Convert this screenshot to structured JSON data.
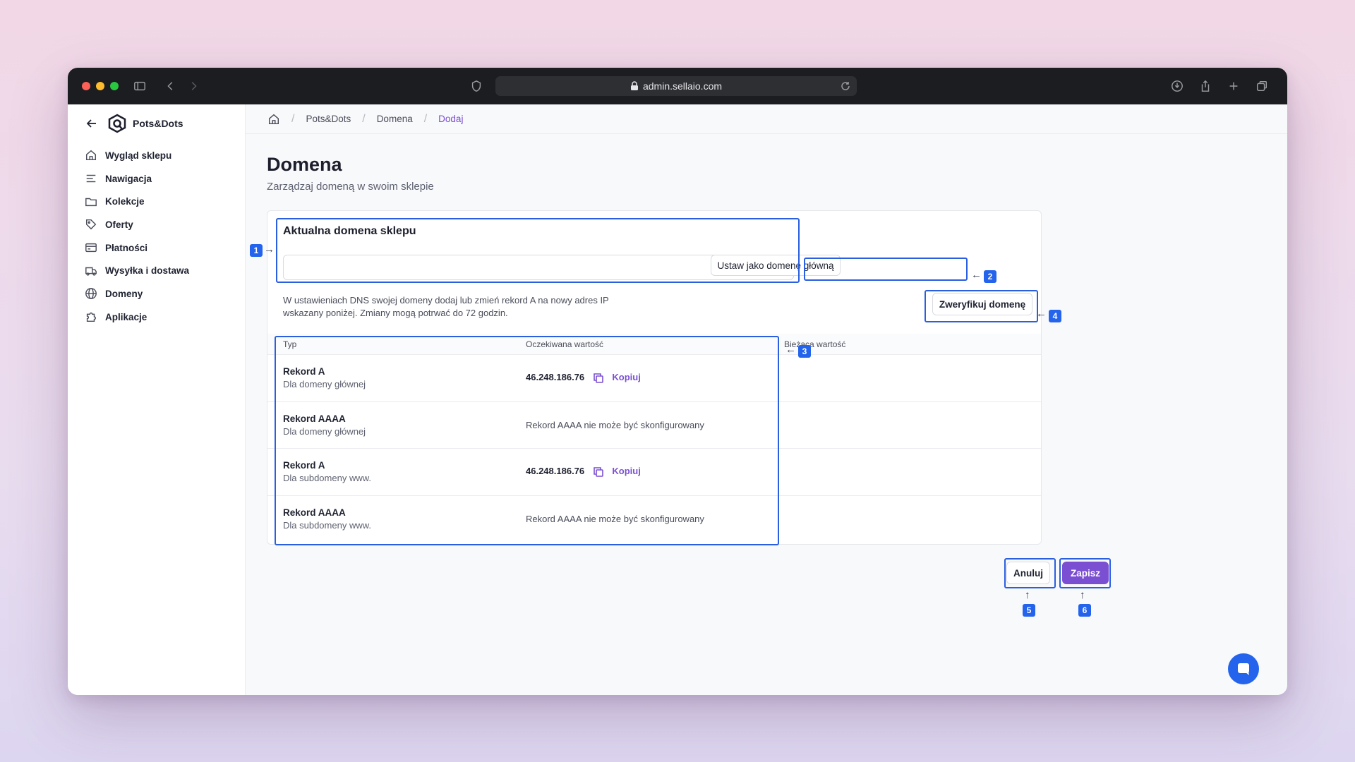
{
  "browser": {
    "url": "admin.sellaio.com"
  },
  "sidebar": {
    "store_name": "Pots&Dots",
    "items": [
      {
        "label": "Wygląd sklepu",
        "icon": "home-icon"
      },
      {
        "label": "Nawigacja",
        "icon": "menu-lines-icon"
      },
      {
        "label": "Kolekcje",
        "icon": "folder-icon"
      },
      {
        "label": "Oferty",
        "icon": "tag-icon"
      },
      {
        "label": "Płatności",
        "icon": "card-icon"
      },
      {
        "label": "Wysyłka i dostawa",
        "icon": "truck-icon"
      },
      {
        "label": "Domeny",
        "icon": "globe-icon"
      },
      {
        "label": "Aplikacje",
        "icon": "puzzle-icon"
      }
    ]
  },
  "breadcrumb": {
    "items": [
      "Pots&Dots",
      "Domena",
      "Dodaj"
    ]
  },
  "page": {
    "title": "Domena",
    "subtitle": "Zarządzaj domeną w swoim sklepie"
  },
  "domain": {
    "section_title": "Aktualna domena sklepu",
    "input_value": "",
    "set_main_label": "Ustaw jako domenę główną",
    "verify_label": "Zweryfikuj domenę",
    "note": "W ustawieniach DNS swojej domeny dodaj lub zmień rekord A na nowy adres IP wskazany poniżej. Zmiany mogą potrwać do 72 godzin."
  },
  "table": {
    "headers": {
      "type": "Typ",
      "expected": "Oczekiwana wartość",
      "current": "Bieżąca wartość"
    },
    "copy_label": "Kopiuj",
    "rows": [
      {
        "type": "Rekord A",
        "sub": "Dla domeny głównej",
        "expected": "46.248.186.76",
        "copyable": true
      },
      {
        "type": "Rekord AAAA",
        "sub": "Dla domeny głównej",
        "expected": "Rekord AAAA nie może być skonfigurowany",
        "copyable": false
      },
      {
        "type": "Rekord A",
        "sub": "Dla subdomeny www.",
        "expected": "46.248.186.76",
        "copyable": true
      },
      {
        "type": "Rekord AAAA",
        "sub": "Dla subdomeny www.",
        "expected": "Rekord AAAA nie może być skonfigurowany",
        "copyable": false
      }
    ]
  },
  "actions": {
    "cancel_label": "Anuluj",
    "save_label": "Zapisz"
  },
  "annotations": {
    "labels": [
      "1",
      "2",
      "3",
      "4",
      "5",
      "6"
    ]
  },
  "colors": {
    "accent": "#7b4fd1",
    "highlight": "#2a5fe0",
    "badge": "#2463eb"
  }
}
